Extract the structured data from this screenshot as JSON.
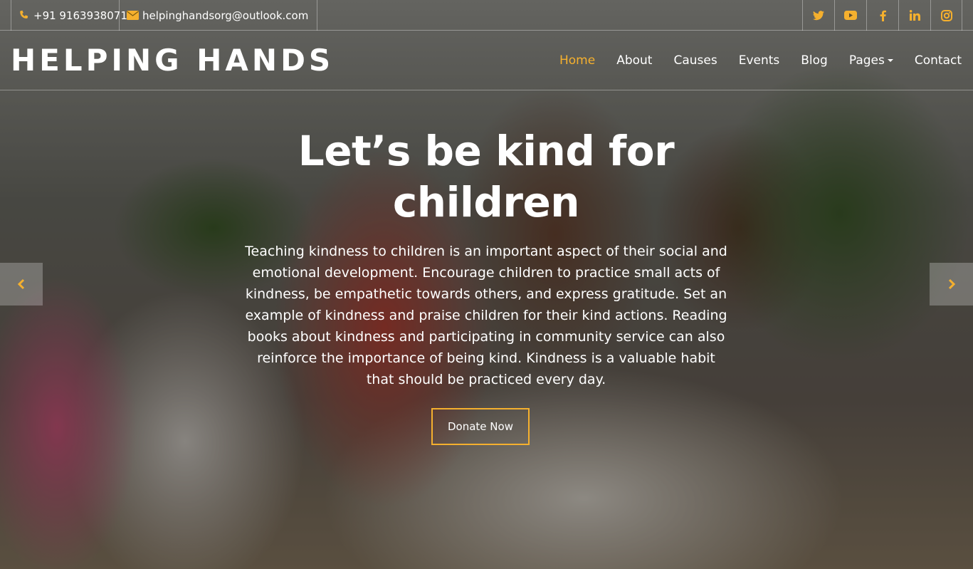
{
  "topbar": {
    "phone": "+91 9163938071",
    "email": "helpinghandsorg@outlook.com",
    "social": [
      "twitter-icon",
      "youtube-icon",
      "facebook-icon",
      "linkedin-icon",
      "instagram-icon"
    ]
  },
  "brand": "HELPING HANDS",
  "nav": {
    "items": [
      {
        "label": "Home",
        "active": true
      },
      {
        "label": "About"
      },
      {
        "label": "Causes"
      },
      {
        "label": "Events"
      },
      {
        "label": "Blog"
      },
      {
        "label": "Pages",
        "dropdown": true
      },
      {
        "label": "Contact"
      }
    ]
  },
  "hero": {
    "title_line1": "Let’s be kind for",
    "title_line2": "children",
    "text": "Teaching kindness to children is an important aspect of their social and emotional development. Encourage children to practice small acts of kindness, be empathetic towards others, and express gratitude. Set an example of kindness and praise children for their kind actions. Reading books about kindness and participating in community service can also reinforce the importance of being kind. Kindness is a valuable habit that should be practiced every day.",
    "button": "Donate Now"
  },
  "colors": {
    "accent": "#f5b02e",
    "text": "#ffffff"
  }
}
